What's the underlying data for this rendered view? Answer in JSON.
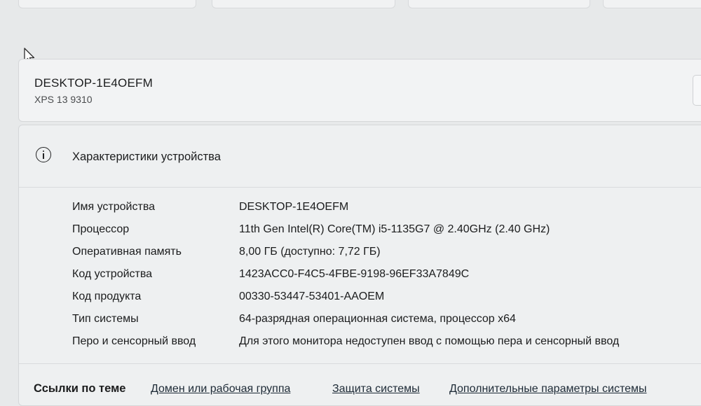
{
  "device": {
    "name": "DESKTOP-1E4OEFM",
    "model": "XPS 13 9310"
  },
  "specs": {
    "title": "Характеристики устройства",
    "rows": [
      {
        "label": "Имя устройства",
        "value": "DESKTOP-1E4OEFM"
      },
      {
        "label": "Процессор",
        "value": "11th Gen Intel(R) Core(TM) i5-1135G7 @ 2.40GHz (2.40 GHz)"
      },
      {
        "label": "Оперативная память",
        "value": "8,00 ГБ (доступно: 7,72 ГБ)"
      },
      {
        "label": "Код устройства",
        "value": "1423ACC0-F4C5-4FBE-9198-96EF33A7849C"
      },
      {
        "label": "Код продукта",
        "value": "00330-53447-53401-AAOEM"
      },
      {
        "label": "Тип системы",
        "value": "64-разрядная операционная система, процессор x64"
      },
      {
        "label": "Перо и сенсорный ввод",
        "value": "Для этого монитора недоступен ввод с помощью пера и сенсорный ввод"
      }
    ]
  },
  "related": {
    "title": "Ссылки по теме",
    "links": [
      "Домен или рабочая группа",
      "Защита системы",
      "Дополнительные параметры системы"
    ]
  }
}
